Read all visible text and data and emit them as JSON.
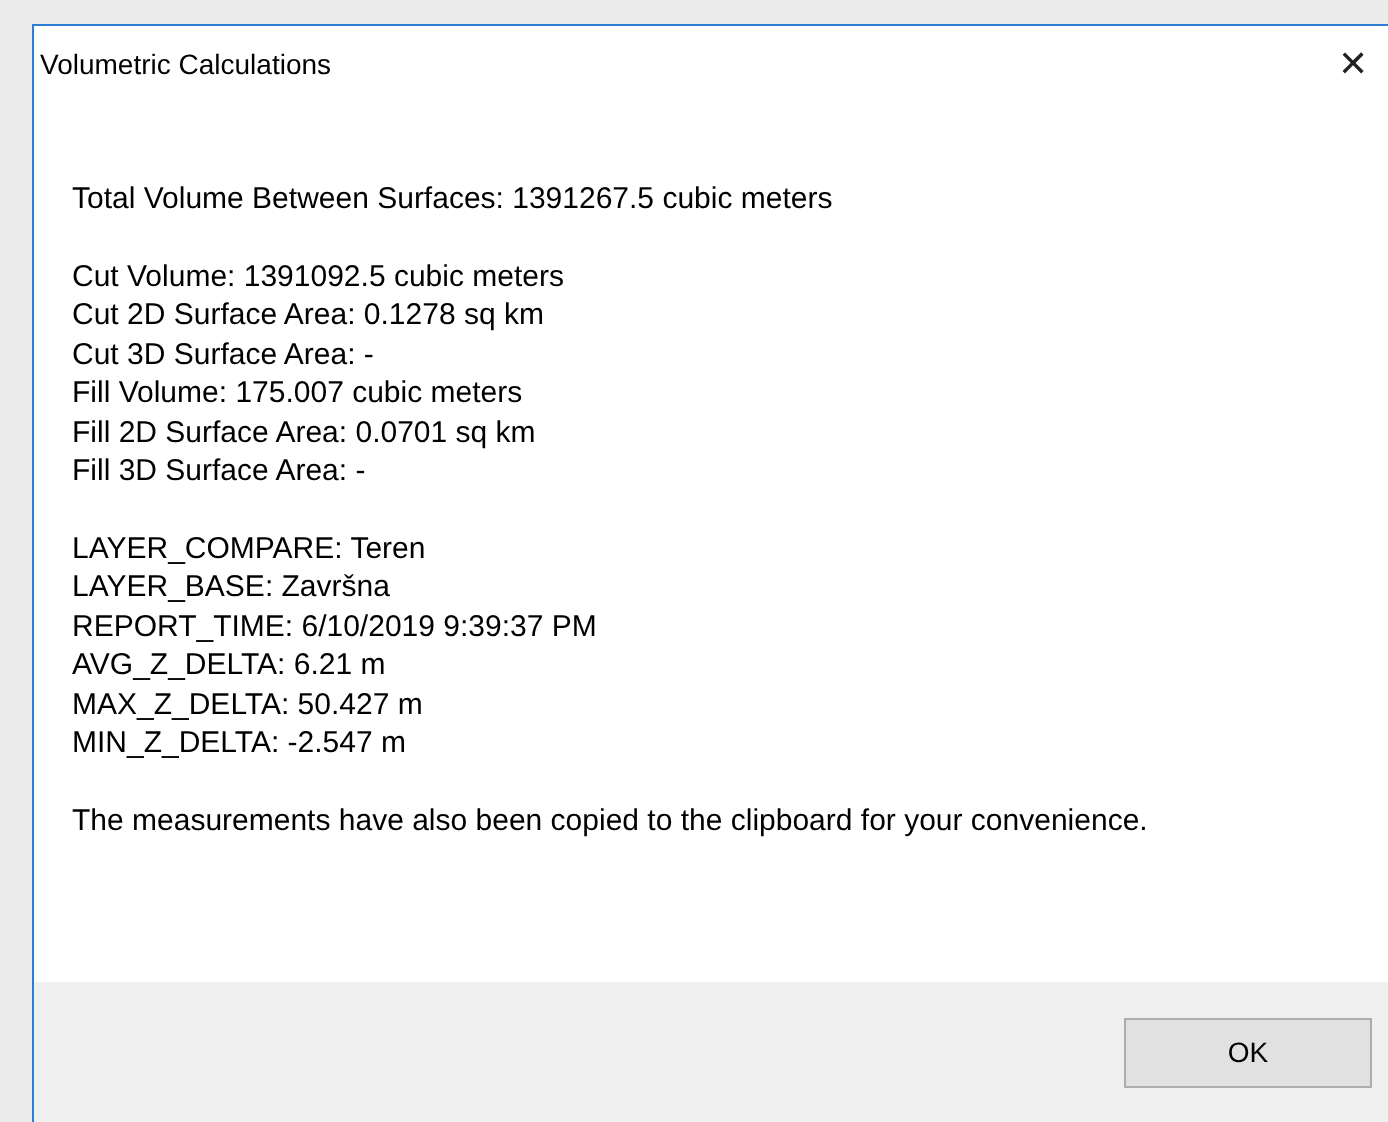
{
  "window": {
    "title": "Volumetric Calculations",
    "close": "✕"
  },
  "paragraphs": [
    [
      "Total Volume Between Surfaces: 1391267.5 cubic meters"
    ],
    [
      "Cut Volume: 1391092.5 cubic meters",
      "Cut 2D Surface Area: 0.1278 sq km",
      "Cut 3D Surface Area: -",
      "Fill Volume: 175.007 cubic meters",
      "Fill 2D Surface Area: 0.0701 sq km",
      "Fill 3D Surface Area: -"
    ],
    [
      "LAYER_COMPARE: Teren",
      "LAYER_BASE: Završna",
      "REPORT_TIME: 6/10/2019 9:39:37 PM",
      "AVG_Z_DELTA: 6.21 m",
      "MAX_Z_DELTA: 50.427 m",
      "MIN_Z_DELTA: -2.547 m"
    ],
    [
      "The measurements have also been copied to the clipboard for your convenience."
    ]
  ],
  "buttons": [
    "OK"
  ]
}
